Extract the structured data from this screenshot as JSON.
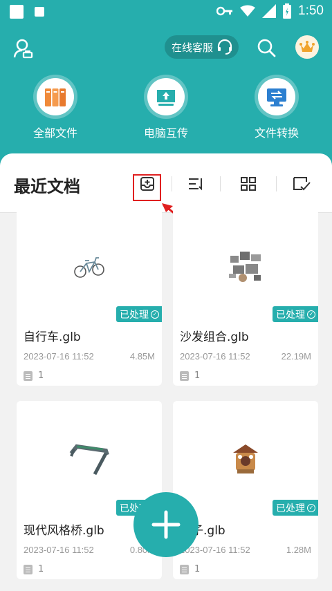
{
  "status_bar": {
    "time": "1:50"
  },
  "header": {
    "service_label": "在线客服"
  },
  "quick_actions": [
    {
      "label": "全部文件",
      "icon": "folders-icon"
    },
    {
      "label": "电脑互传",
      "icon": "pc-transfer-icon"
    },
    {
      "label": "文件转换",
      "icon": "convert-icon"
    }
  ],
  "recent": {
    "title": "最近文档",
    "files": [
      {
        "name": "自行车.glb",
        "badge": "已处理",
        "date": "2023-07-16 11:52",
        "size": "4.85M",
        "pages": "1"
      },
      {
        "name": "沙发组合.glb",
        "badge": "已处理",
        "date": "2023-07-16 11:52",
        "size": "22.19M",
        "pages": "1"
      },
      {
        "name": "现代风格桥.glb",
        "badge": "已处理",
        "date": "2023-07-16 11:52",
        "size": "0.80M",
        "pages": "1"
      },
      {
        "name": "亭子.glb",
        "badge": "已处理",
        "date": "2023-07-16 11:52",
        "size": "1.28M",
        "pages": "1"
      }
    ]
  },
  "colors": {
    "accent": "#26aead",
    "highlight": "#e02020"
  }
}
